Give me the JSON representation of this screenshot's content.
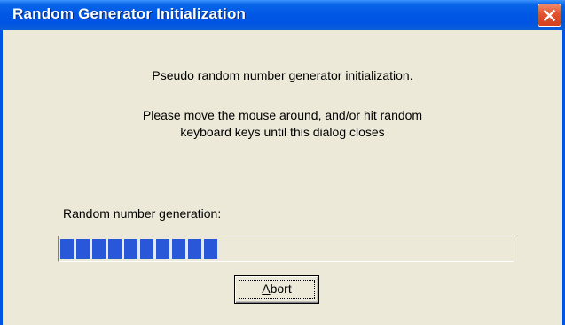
{
  "window": {
    "title": "Random Generator Initialization",
    "close_icon": "close-icon"
  },
  "message": {
    "line1": "Pseudo random number generator initialization.",
    "line2": "Please move the mouse around, and/or hit random",
    "line3": "keyboard keys until this dialog closes"
  },
  "progress": {
    "label": "Random number generation:",
    "segments_filled": 10,
    "fill_color": "#2858d8"
  },
  "buttons": {
    "abort_label_mnemonic": "A",
    "abort_label_rest": "bort"
  },
  "colors": {
    "titlebar": "#0054e3",
    "background": "#ece9d8",
    "close_button": "#e2522e"
  }
}
